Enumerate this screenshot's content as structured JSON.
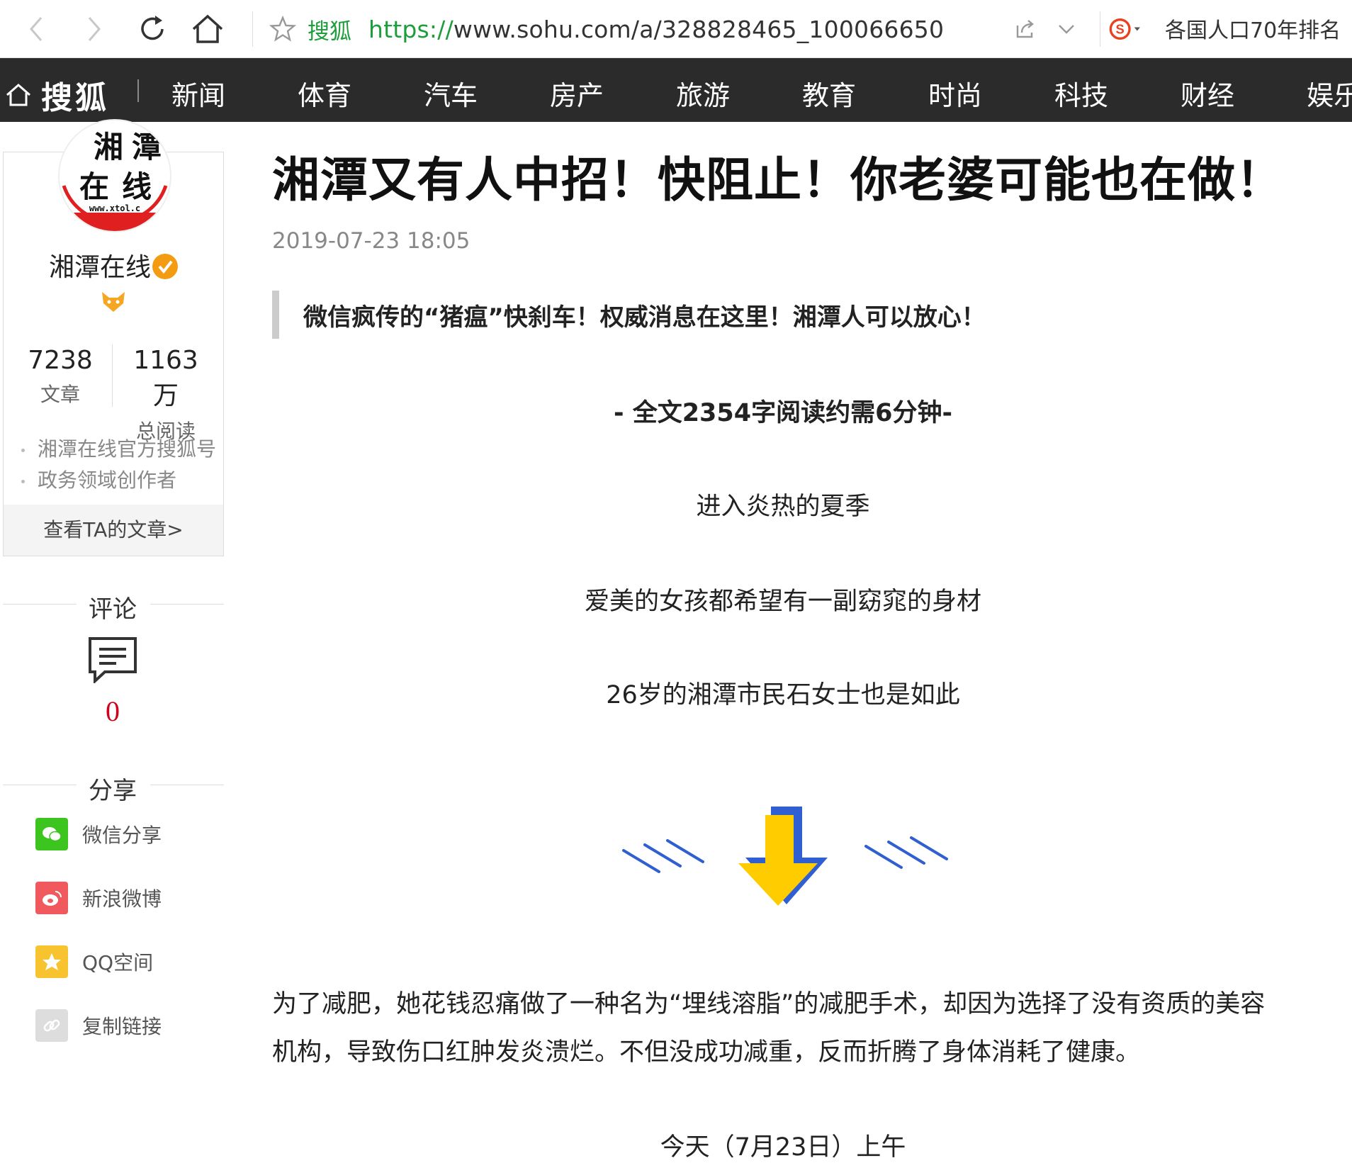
{
  "browser": {
    "site_name": "搜狐",
    "url_protocol": "https://",
    "url_rest": "www.sohu.com/a/328828465_100066650",
    "search_suggestion": "各国人口70年排名"
  },
  "site_nav": {
    "logo_text": "搜狐",
    "items": [
      "新闻",
      "体育",
      "汽车",
      "房产",
      "旅游",
      "教育",
      "时尚",
      "科技",
      "财经",
      "娱乐"
    ]
  },
  "author": {
    "avatar_text": [
      "湘",
      "潭",
      "在",
      "线"
    ],
    "avatar_url_text": "www.xtol.c",
    "name": "湘潭在线",
    "articles_count": "7238",
    "articles_label": "文章",
    "reads_count": "1163万",
    "reads_label": "总阅读",
    "tags": [
      "湘潭在线官方搜狐号",
      "政务领域创作者"
    ],
    "view_articles": "查看TA的文章>"
  },
  "comments": {
    "title": "评论",
    "count": "0"
  },
  "share": {
    "title": "分享",
    "items": [
      {
        "label": "微信分享",
        "color": "#3cc51f"
      },
      {
        "label": "新浪微博",
        "color": "#f0595d"
      },
      {
        "label": "QQ空间",
        "color": "#f7c32e"
      },
      {
        "label": "复制链接",
        "color": "#dddddd"
      }
    ]
  },
  "article": {
    "title": "湘潭又有人中招！快阻止！你老婆可能也在做！",
    "time": "2019-07-23 18:05",
    "lead": "微信疯传的“猪瘟”快刹车！权威消息在这里！湘潭人可以放心！",
    "wordcount": "- 全文2354字阅读约需6分钟-",
    "lines": [
      "进入炎热的夏季",
      "爱美的女孩都希望有一副窈窕的身材",
      "26岁的湘潭市民石女士也是如此"
    ],
    "paragraph_lines": [
      "为了减肥，她花钱忍痛做了一种名为“埋线溶脂”的减肥手术，却因为选择了没有资质的美容",
      "机构，导致伤口红肿发炎溃烂。不但没成功减重，反而折腾了身体消耗了健康。"
    ],
    "next_line": "今天（7月23日）上午"
  },
  "colors": {
    "nav_bg": "#2b2b2b",
    "url_green": "#1e9e3a",
    "comment_red": "#d0021b",
    "arrow_yellow": "#ffcc00",
    "arrow_blue": "#2f5fd0"
  }
}
